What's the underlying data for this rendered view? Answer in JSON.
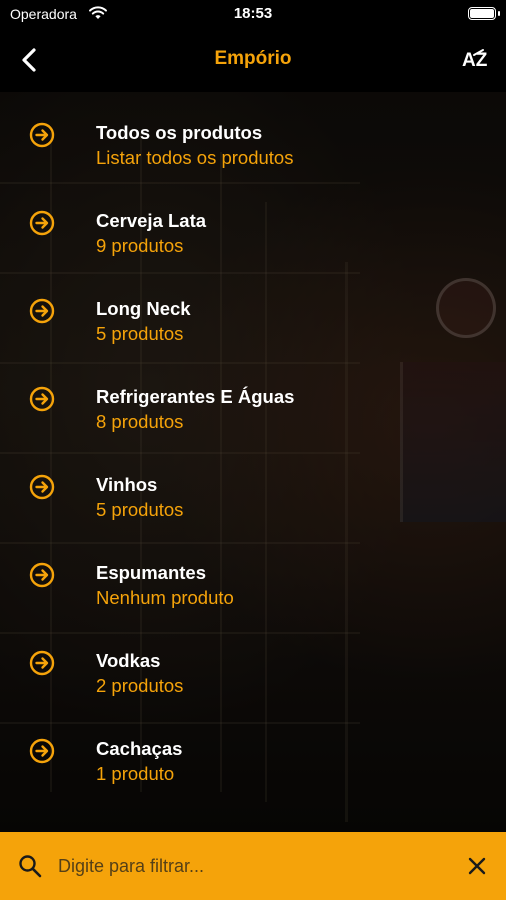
{
  "status_bar": {
    "carrier": "Operadora",
    "time": "18:53"
  },
  "nav": {
    "title": "Empório",
    "back_icon": "chevron-left-icon",
    "sort_icon": "sort-az-icon",
    "sort_label": "AZ"
  },
  "colors": {
    "accent": "#f5a30a",
    "background": "#000000",
    "text_primary": "#ffffff"
  },
  "categories": [
    {
      "title": "Todos os produtos",
      "subtitle": "Listar todos os produtos"
    },
    {
      "title": "Cerveja Lata",
      "subtitle": "9 produtos"
    },
    {
      "title": "Long Neck",
      "subtitle": "5 produtos"
    },
    {
      "title": "Refrigerantes E Águas",
      "subtitle": "8 produtos"
    },
    {
      "title": "Vinhos",
      "subtitle": "5 produtos"
    },
    {
      "title": "Espumantes",
      "subtitle": "Nenhum produto"
    },
    {
      "title": "Vodkas",
      "subtitle": "2 produtos"
    },
    {
      "title": "Cachaças",
      "subtitle": "1 produto"
    }
  ],
  "filter": {
    "placeholder": "Digite para filtrar...",
    "value": "",
    "search_icon": "search-icon",
    "clear_icon": "close-icon"
  }
}
